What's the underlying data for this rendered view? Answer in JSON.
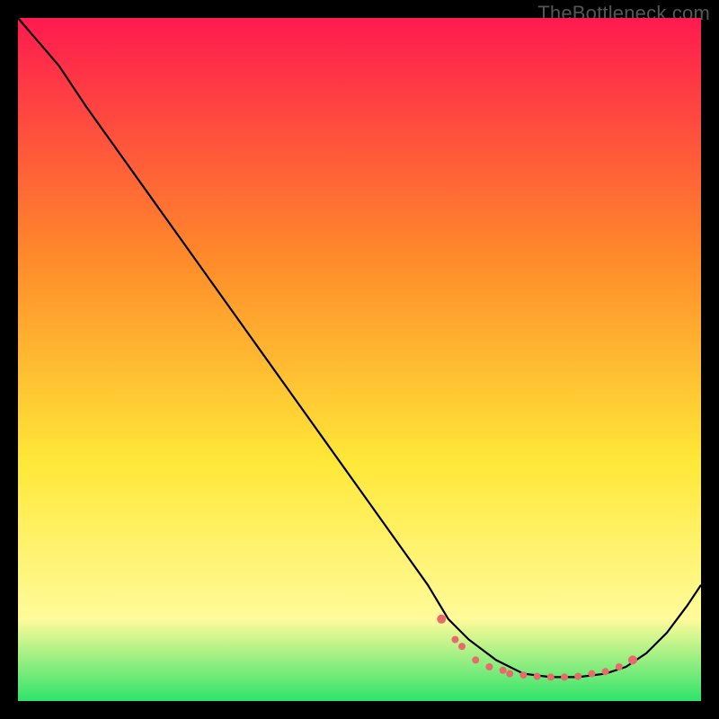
{
  "attribution": "TheBottleneck.com",
  "colors": {
    "gradient_top": "#ff1a4f",
    "gradient_mid1": "#ff8a2a",
    "gradient_mid2": "#ffe838",
    "gradient_mid3": "#fffb9a",
    "gradient_bottom": "#2fe36a",
    "line": "#000000",
    "marker": "#e86a6a",
    "bg": "#000000"
  },
  "chart_data": {
    "type": "line",
    "title": "",
    "xlabel": "",
    "ylabel": "",
    "xlim": [
      0,
      100
    ],
    "ylim": [
      0,
      100
    ],
    "series": [
      {
        "name": "curve",
        "x": [
          0,
          6,
          10,
          15,
          20,
          25,
          30,
          35,
          40,
          45,
          50,
          55,
          60,
          63,
          66,
          70,
          74,
          78,
          82,
          86,
          89,
          92,
          95,
          98,
          100
        ],
        "y": [
          100,
          93,
          87,
          80,
          73,
          66,
          59,
          52,
          45,
          38,
          31,
          24,
          17,
          12,
          9,
          6,
          4,
          3.5,
          3.5,
          4,
          5,
          7,
          10,
          14,
          17
        ]
      }
    ],
    "markers": {
      "name": "valley-points",
      "x": [
        62,
        64,
        65,
        67,
        69,
        71,
        72,
        74,
        76,
        78,
        80,
        82,
        84,
        86,
        88,
        90
      ],
      "y": [
        12,
        9,
        8,
        6,
        5,
        4.5,
        4,
        3.8,
        3.6,
        3.5,
        3.5,
        3.6,
        4,
        4.3,
        5,
        6
      ]
    }
  }
}
